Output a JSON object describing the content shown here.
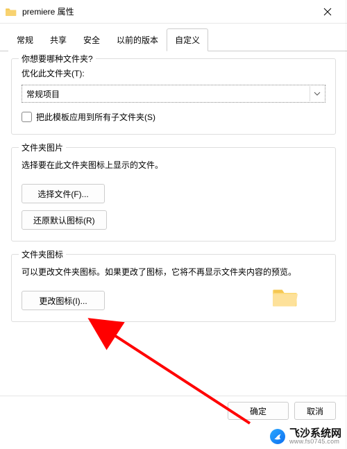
{
  "titlebar": {
    "icon": "folder-icon",
    "title": "premiere 属性"
  },
  "tabs": [
    {
      "label": "常规"
    },
    {
      "label": "共享"
    },
    {
      "label": "安全"
    },
    {
      "label": "以前的版本"
    },
    {
      "label": "自定义",
      "active": true
    }
  ],
  "group1": {
    "title": "你想要哪种文件夹?",
    "optimize_label": "优化此文件夹(T):",
    "optimize_value": "常规项目",
    "apply_template_label": "把此模板应用到所有子文件夹(S)"
  },
  "group2": {
    "title": "文件夹图片",
    "desc": "选择要在此文件夹图标上显示的文件。",
    "choose_btn": "选择文件(F)...",
    "restore_btn": "还原默认图标(R)"
  },
  "group3": {
    "title": "文件夹图标",
    "desc": "可以更改文件夹图标。如果更改了图标，它将不再显示文件夹内容的预览。",
    "change_btn": "更改图标(I)..."
  },
  "footer": {
    "ok": "确定",
    "cancel": "取消"
  },
  "watermark": {
    "name": "飞沙系统网",
    "url": "www.fs0745.com"
  }
}
